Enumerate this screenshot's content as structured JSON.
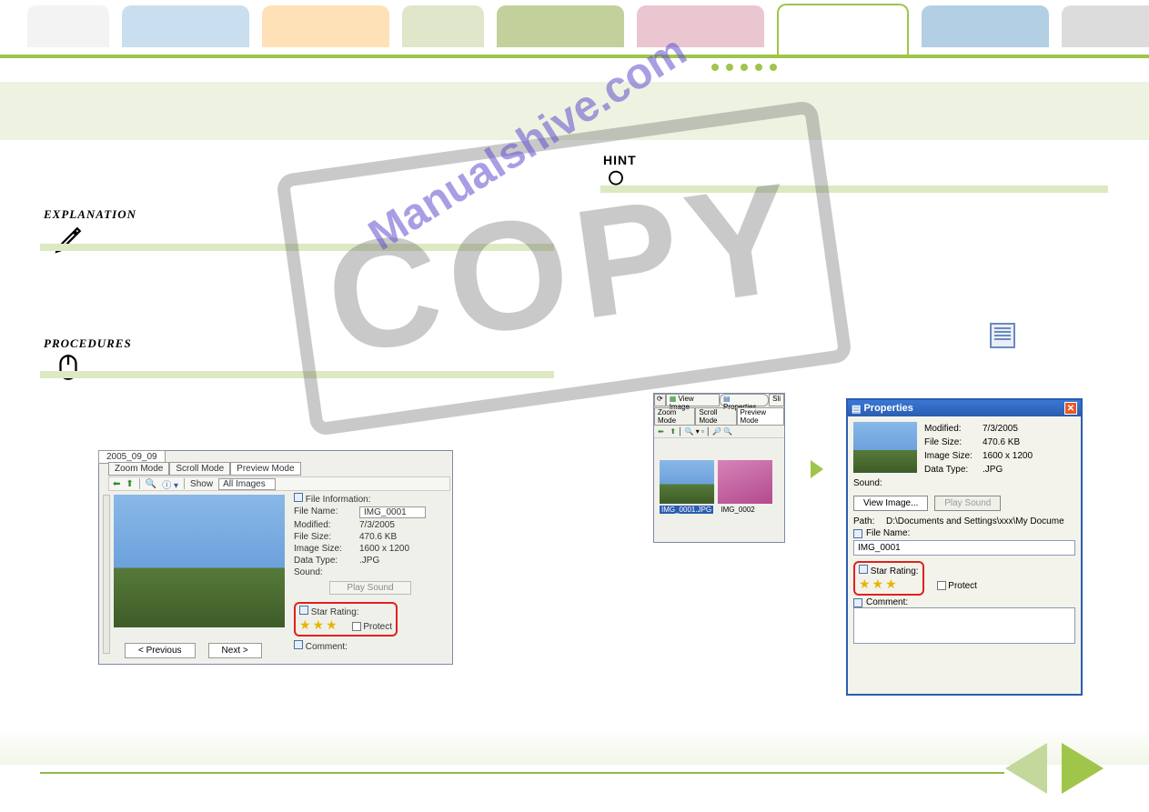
{
  "watermark_text": "COPY",
  "watermark_url": "Manualshive.com",
  "hint_label": "HINT",
  "explanation_label": "EXPLANATION",
  "procedures_label": "PROCEDURES",
  "preview": {
    "date": "2005_09_09",
    "tabs": [
      "Zoom Mode",
      "Scroll Mode",
      "Preview Mode"
    ],
    "show_label": "Show",
    "show_value": "All Images",
    "file_info_header": "File Information:",
    "rows": {
      "filename_k": "File Name:",
      "filename_v": "IMG_0001",
      "modified_k": "Modified:",
      "modified_v": "7/3/2005",
      "filesize_k": "File Size:",
      "filesize_v": "470.6 KB",
      "imgsize_k": "Image Size:",
      "imgsize_v": "1600 x 1200",
      "datatype_k": "Data Type:",
      "datatype_v": ".JPG",
      "sound_k": "Sound:"
    },
    "play_sound": "Play Sound",
    "star_label": "Star Rating:",
    "stars": "★★★",
    "protect": "Protect",
    "comment_label": "Comment:",
    "prev_btn": "<  Previous",
    "next_btn": "Next  >"
  },
  "scroll": {
    "view_image": "View Image",
    "properties": "Properties",
    "tabs": [
      "Zoom Mode",
      "Scroll Mode",
      "Preview Mode"
    ],
    "sel_file": "IMG_0001.JPG",
    "file2": "IMG_0002"
  },
  "dialog": {
    "title": "Properties",
    "modified_k": "Modified:",
    "modified_v": "7/3/2005",
    "filesize_k": "File Size:",
    "filesize_v": "470.6 KB",
    "imgsize_k": "Image Size:",
    "imgsize_v": "1600 x 1200",
    "datatype_k": "Data Type:",
    "datatype_v": ".JPG",
    "sound_k": "Sound:",
    "view_image_btn": "View Image...",
    "play_sound_btn": "Play Sound",
    "path_k": "Path:",
    "path_v": "D:\\Documents and Settings\\xxx\\My Docume",
    "filename_label": "File Name:",
    "filename_value": "IMG_0001",
    "star_label": "Star Rating:",
    "stars": "★★★",
    "protect": "Protect",
    "comment_label": "Comment:"
  }
}
